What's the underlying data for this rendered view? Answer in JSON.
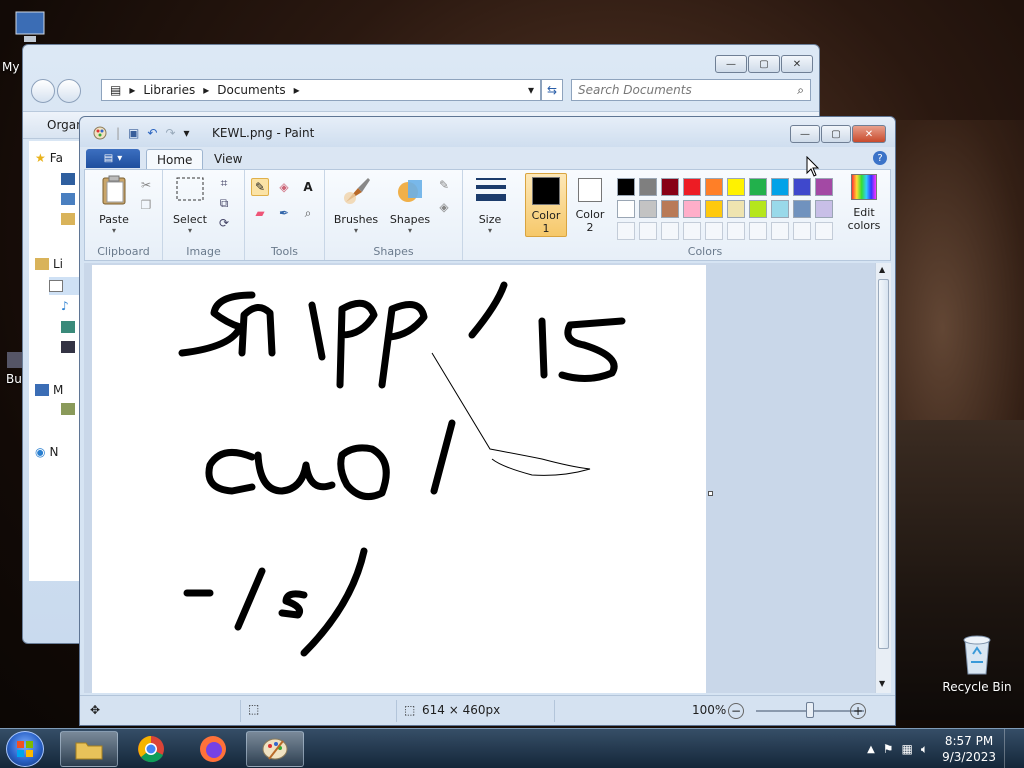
{
  "desktop": {
    "icons": [
      {
        "label": "My",
        "name": "my-computer"
      },
      {
        "label": "Bu",
        "name": "partial-icon"
      },
      {
        "label": "Recycle Bin",
        "name": "recycle-bin"
      }
    ]
  },
  "explorer": {
    "breadcrumb": [
      "Libraries",
      "Documents"
    ],
    "search_placeholder": "Search Documents",
    "toolbar_label": "Organ",
    "nav_items": [
      "Fa",
      "Li",
      "M",
      "N"
    ]
  },
  "paint": {
    "title": "KEWL.png - Paint",
    "tabs": [
      "Home",
      "View"
    ],
    "groups": {
      "clipboard": {
        "label": "Clipboard",
        "paste": "Paste"
      },
      "image": {
        "label": "Image",
        "select": "Select"
      },
      "tools": {
        "label": "Tools"
      },
      "shapes": {
        "label": "Shapes",
        "brushes": "Brushes",
        "shapes": "Shapes"
      },
      "size": {
        "label": "Size"
      },
      "colors": {
        "label": "Colors",
        "color1": "Color\n1",
        "color1_line1": "Color",
        "color1_line2": "1",
        "color2_line1": "Color",
        "color2_line2": "2",
        "edit_line1": "Edit",
        "edit_line2": "colors"
      }
    },
    "palette": {
      "row1": [
        "#000000",
        "#7f7f7f",
        "#880015",
        "#ed1c24",
        "#ff7f27",
        "#fff200",
        "#22b14c",
        "#00a2e8",
        "#3f48cc",
        "#a349a4"
      ],
      "row2": [
        "#ffffff",
        "#c3c3c3",
        "#b97a57",
        "#ffaec9",
        "#ffc90e",
        "#efe4b0",
        "#b5e61d",
        "#99d9ea",
        "#7092be",
        "#c8bfe7"
      ],
      "color1": "#000000",
      "color2": "#ffffff"
    },
    "status": {
      "dimensions": "614 × 460px",
      "zoom": "100%"
    }
  },
  "taskbar": {
    "time": "8:57 PM",
    "date": "9/3/2023"
  }
}
